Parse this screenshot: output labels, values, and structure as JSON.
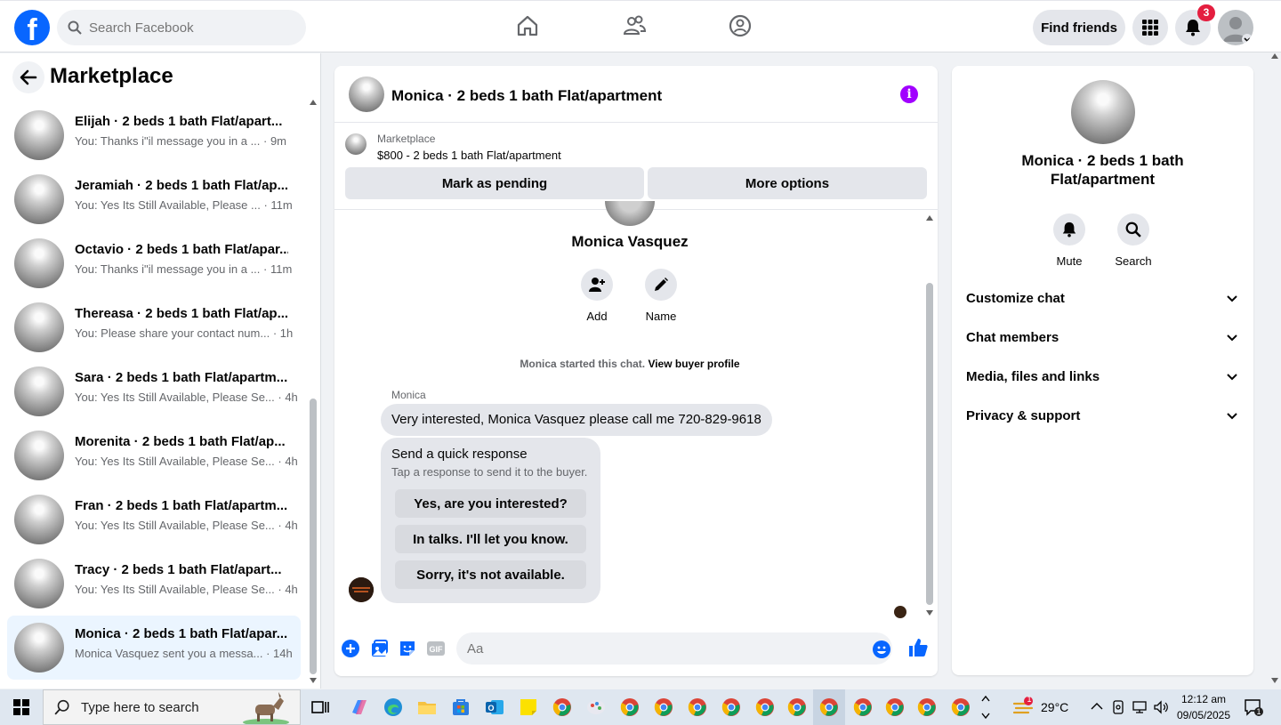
{
  "topbar": {
    "logo": "f",
    "search_placeholder": "Search Facebook",
    "find_friends": "Find friends",
    "notifications_count": "3"
  },
  "sidebar": {
    "title": "Marketplace",
    "conversations": [
      {
        "name": "Elijah · 2 beds 1 bath Flat/apart...",
        "msg": "You: Thanks i\"il message you in a ... · 9m",
        "active": false
      },
      {
        "name": "Jeramiah · 2 beds 1 bath Flat/ap...",
        "msg": "You: Yes Its Still Available, Please ... · 11m",
        "active": false
      },
      {
        "name": "Octavio · 2 beds 1 bath Flat/apar...",
        "msg": "You: Thanks i\"il message you in a ... · 11m",
        "active": false
      },
      {
        "name": "Thereasa · 2 beds 1 bath Flat/ap...",
        "msg": "You: Please share your contact num... · 1h",
        "active": false
      },
      {
        "name": "Sara · 2 beds 1 bath Flat/apartm...",
        "msg": "You: Yes Its Still Available, Please Se... · 4h",
        "active": false
      },
      {
        "name": "Morenita · 2 beds 1 bath Flat/ap...",
        "msg": "You: Yes Its Still Available, Please Se... · 4h",
        "active": false
      },
      {
        "name": "Fran · 2 beds 1 bath Flat/apartm...",
        "msg": "You: Yes Its Still Available, Please Se... · 4h",
        "active": false
      },
      {
        "name": "Tracy · 2 beds 1 bath Flat/apart...",
        "msg": "You: Yes Its Still Available, Please Se... · 4h",
        "active": false
      },
      {
        "name": "Monica · 2 beds 1 bath Flat/apar...",
        "msg": "Monica Vasquez sent you a messa... · 14h",
        "active": true
      }
    ]
  },
  "chat": {
    "title": "Monica · 2 beds 1 bath Flat/apartment",
    "listing_source": "Marketplace",
    "listing_price": "$800 - 2 beds 1 bath Flat/apartment",
    "mark_pending": "Mark as pending",
    "more_options": "More options",
    "profile_name": "Monica Vasquez",
    "add_label": "Add",
    "name_label": "Name",
    "started_text": "Monica started this chat.",
    "view_profile": "View buyer profile",
    "sender": "Monica",
    "message": "Very interested,  Monica Vasquez please call me 720-829-9618",
    "quick_title": "Send a quick response",
    "quick_sub": "Tap a response to send it to the buyer.",
    "quick_responses": [
      "Yes, are you interested?",
      "In talks. I'll let you know.",
      "Sorry, it's not available."
    ],
    "composer_placeholder": "Aa"
  },
  "details": {
    "title": "Monica · 2 beds 1 bath Flat/apartment",
    "mute": "Mute",
    "search": "Search",
    "rows": [
      "Customize chat",
      "Chat members",
      "Media, files and links",
      "Privacy & support"
    ]
  },
  "taskbar": {
    "search_text": "Type here to search",
    "weather": "29°C",
    "weather_badge": "1",
    "time": "12:12 am",
    "date": "09/05/2025",
    "notif_count": "1"
  },
  "colors": {
    "brand": "#0866ff",
    "badge": "#e41e3f",
    "info": "#a100ff",
    "active_row": "#ebf5ff"
  }
}
